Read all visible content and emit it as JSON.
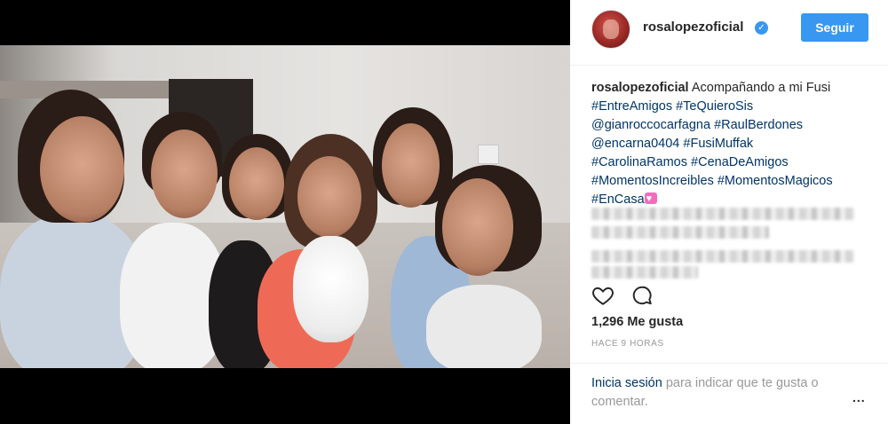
{
  "post": {
    "username": "rosalopezoficial",
    "verified_badge": "✓",
    "follow_label": "Seguir",
    "caption": {
      "author": "rosalopezoficial",
      "text": "Acompañando a mi Fusi",
      "tags": [
        "#EntreAmigos",
        "#TeQuieroSis",
        "@gianroccocarfagna",
        "#RaulBerdones",
        "@encarna0404",
        "#FusiMuffak",
        "#CarolinaRamos",
        "#CenaDeAmigos",
        "#MomentosIncreibles",
        "#MomentosMagicos",
        "#EnCasa"
      ],
      "emoji": "heart-emoji"
    },
    "likes": "1,296 Me gusta",
    "timestamp": "HACE 9 HORAS",
    "login_prompt": {
      "link": "Inicia sesión",
      "text": "para indicar que te gusta o comentar."
    },
    "more_label": "..."
  },
  "colors": {
    "accent": "#3897f0",
    "tag": "#003569",
    "text": "#262626",
    "muted": "#999999"
  },
  "icons": [
    "heart-icon",
    "comment-icon",
    "verified-icon",
    "more-icon"
  ]
}
